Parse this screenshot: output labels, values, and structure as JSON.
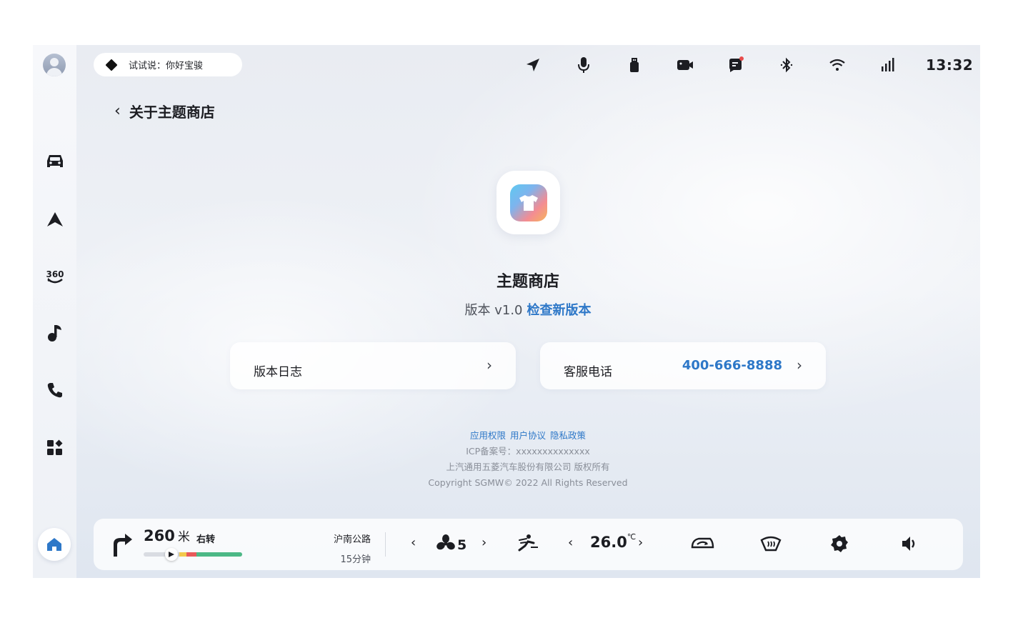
{
  "voice": {
    "hint": "试试说：你好宝骏"
  },
  "status_bar": {
    "icons": [
      "navigation-icon",
      "microphone-icon",
      "usb-icon",
      "camera-icon",
      "message-icon",
      "bluetooth-icon",
      "wifi-icon",
      "signal-icon"
    ],
    "time": "13:32"
  },
  "sidebar": {
    "items": [
      {
        "name": "car-icon"
      },
      {
        "name": "navigation-icon"
      },
      {
        "name": "360-view-icon",
        "label": "360"
      },
      {
        "name": "music-icon"
      },
      {
        "name": "phone-icon"
      },
      {
        "name": "apps-icon"
      }
    ],
    "home": "home-icon"
  },
  "page": {
    "back_label": "关于主题商店",
    "app_name": "主题商店",
    "version_text": "版本 v1.0",
    "check_update": "检查新版本"
  },
  "cards": {
    "changelog_label": "版本日志",
    "hotline_label": "客服电话",
    "hotline_number": "400-666-8888"
  },
  "footer": {
    "links": [
      "应用权限",
      "用户协议",
      "隐私政策"
    ],
    "icp": "ICP备案号：xxxxxxxxxxxxxx",
    "company": "上汽通用五菱汽车股份有限公司 版权所有",
    "copyright": "Copyright SGMW© 2022 All Rights Reserved"
  },
  "dock": {
    "distance": "260",
    "distance_unit": "米",
    "turn": "右转",
    "route_progress": 0.28,
    "road": "沪南公路",
    "eta": "15分钟",
    "fan_level": "5",
    "temperature": "26.0",
    "temperature_unit": "℃",
    "colors": {
      "yellow": "#f2c94c",
      "red": "#e85a5a",
      "green": "#4cb886"
    }
  }
}
